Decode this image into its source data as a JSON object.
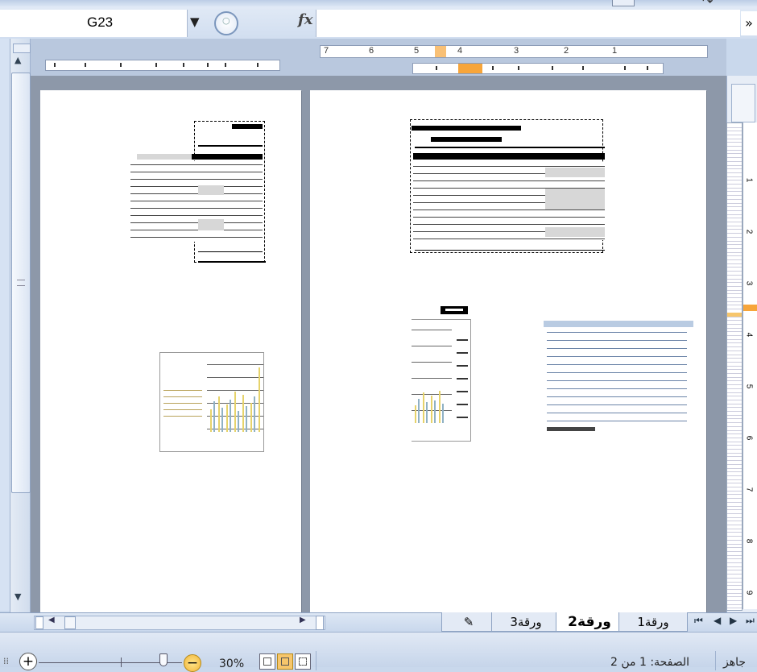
{
  "formula_bar": {
    "name_box": "G23",
    "dropdown_glyph": "▼",
    "fx_label": "fx",
    "expand_glyph": "»"
  },
  "ruler": {
    "numbers": [
      "7",
      "6",
      "5",
      "4",
      "3",
      "2",
      "1"
    ]
  },
  "row_ruler": {
    "numbers": [
      "1",
      "2",
      "3",
      "4",
      "5",
      "6",
      "7",
      "8",
      "9"
    ]
  },
  "sheet_tabs": [
    {
      "label": "ورقة1",
      "active": false
    },
    {
      "label": "ورقة2",
      "active": true
    },
    {
      "label": "ورقة3",
      "active": false
    }
  ],
  "status": {
    "ready": "جاهز",
    "page": "الصفحة: 1 من 2",
    "zoom": "30%"
  },
  "icons": {
    "fx": "fx-icon",
    "new_sheet": "insert-sheet-icon",
    "zoom_in": "zoom-in-icon",
    "zoom_out": "zoom-out-icon"
  },
  "colors": {
    "accent": "#f7a53a",
    "chrome": "#c9d8ec",
    "canvas": "#8d98a9"
  }
}
